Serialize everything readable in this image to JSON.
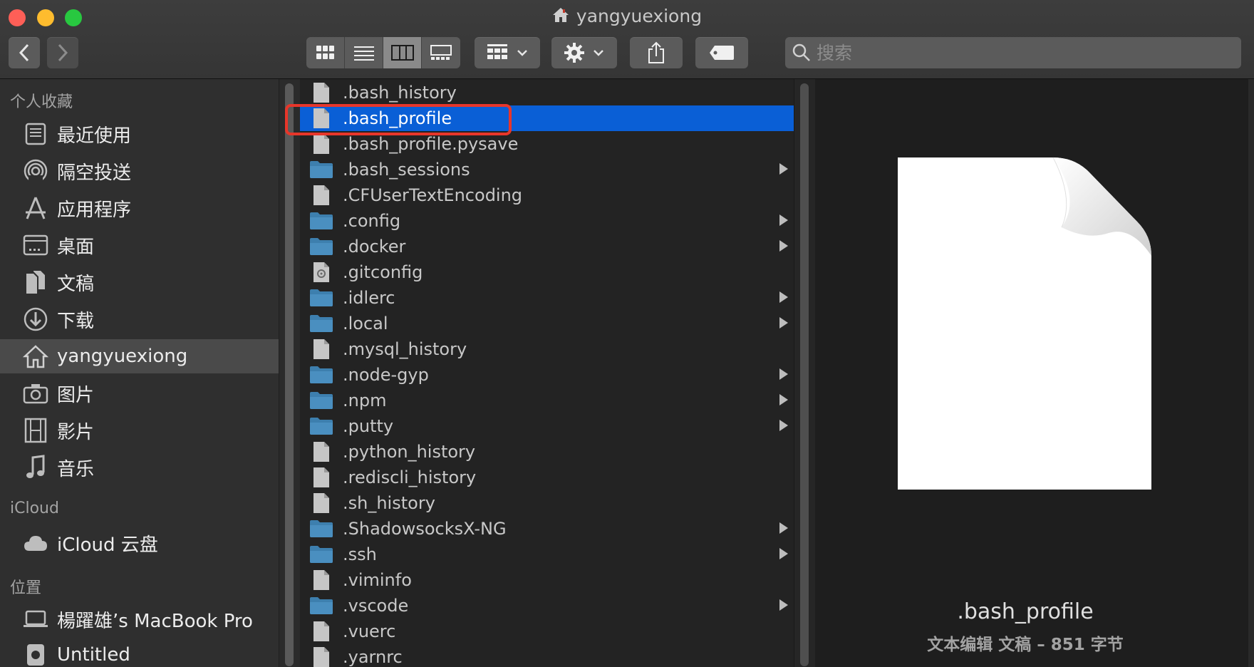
{
  "window": {
    "title": "yangyuexiong"
  },
  "toolbar": {
    "search_placeholder": "搜索"
  },
  "sidebar": {
    "sections": [
      {
        "header": "个人收藏",
        "items": [
          {
            "label": "最近使用",
            "icon": "recents-icon"
          },
          {
            "label": "隔空投送",
            "icon": "airdrop-icon"
          },
          {
            "label": "应用程序",
            "icon": "applications-icon"
          },
          {
            "label": "桌面",
            "icon": "desktop-icon"
          },
          {
            "label": "文稿",
            "icon": "documents-icon"
          },
          {
            "label": "下载",
            "icon": "downloads-icon"
          },
          {
            "label": "yangyuexiong",
            "icon": "home-icon",
            "selected": true
          },
          {
            "label": "图片",
            "icon": "pictures-icon"
          },
          {
            "label": "影片",
            "icon": "movies-icon"
          },
          {
            "label": "音乐",
            "icon": "music-icon"
          }
        ]
      },
      {
        "header": "iCloud",
        "items": [
          {
            "label": "iCloud 云盘",
            "icon": "icloud-icon"
          }
        ]
      },
      {
        "header": "位置",
        "items": [
          {
            "label": "楊躍雄’s MacBook Pro",
            "icon": "laptop-icon"
          },
          {
            "label": "Untitled",
            "icon": "disk-icon"
          }
        ]
      }
    ]
  },
  "files": [
    {
      "name": ".bash_history",
      "kind": "file"
    },
    {
      "name": ".bash_profile",
      "kind": "file",
      "selected": true
    },
    {
      "name": ".bash_profile.pysave",
      "kind": "file"
    },
    {
      "name": ".bash_sessions",
      "kind": "folder"
    },
    {
      "name": ".CFUserTextEncoding",
      "kind": "file"
    },
    {
      "name": ".config",
      "kind": "folder"
    },
    {
      "name": ".docker",
      "kind": "folder"
    },
    {
      "name": ".gitconfig",
      "kind": "config"
    },
    {
      "name": ".idlerc",
      "kind": "folder"
    },
    {
      "name": ".local",
      "kind": "folder"
    },
    {
      "name": ".mysql_history",
      "kind": "file"
    },
    {
      "name": ".node-gyp",
      "kind": "folder"
    },
    {
      "name": ".npm",
      "kind": "folder"
    },
    {
      "name": ".putty",
      "kind": "folder"
    },
    {
      "name": ".python_history",
      "kind": "file"
    },
    {
      "name": ".rediscli_history",
      "kind": "file"
    },
    {
      "name": ".sh_history",
      "kind": "file"
    },
    {
      "name": ".ShadowsocksX-NG",
      "kind": "folder"
    },
    {
      "name": ".ssh",
      "kind": "folder"
    },
    {
      "name": ".viminfo",
      "kind": "file"
    },
    {
      "name": ".vscode",
      "kind": "folder"
    },
    {
      "name": ".vuerc",
      "kind": "file"
    },
    {
      "name": ".yarnrc",
      "kind": "file"
    }
  ],
  "preview": {
    "name": ".bash_profile",
    "info": "文本编辑 文稿 – 851 字节"
  },
  "colors": {
    "selection": "#0a5fd6",
    "highlight_box": "#e8362a",
    "folder": "#4a8fc0"
  }
}
